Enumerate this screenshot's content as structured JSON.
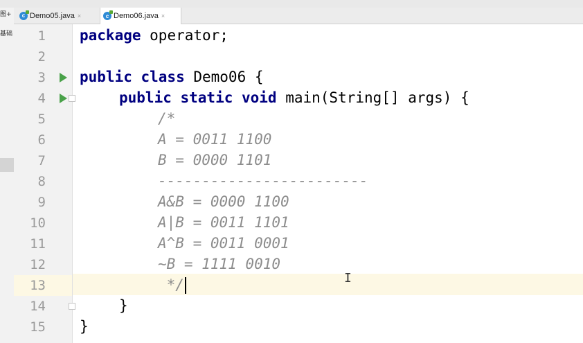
{
  "left_pane": {
    "label_1": "图+",
    "label_2": "基础"
  },
  "tabs": [
    {
      "name": "Demo05.java",
      "active": false,
      "close": "×",
      "icon": "java-class-icon"
    },
    {
      "name": "Demo06.java",
      "active": true,
      "close": "×",
      "icon": "java-class-icon"
    }
  ],
  "gutter": {
    "line_numbers": [
      "1",
      "2",
      "3",
      "4",
      "5",
      "6",
      "7",
      "8",
      "9",
      "10",
      "11",
      "12",
      "13",
      "14",
      "15"
    ],
    "run_markers_on_lines": [
      3,
      4
    ],
    "fold_markers_on_lines": [
      4,
      14
    ]
  },
  "code": {
    "l1_kw": "package",
    "l1_rest": " operator;",
    "l3_kw": "public class",
    "l3_rest": " Demo06 {",
    "l4_kw": "public static void",
    "l4_rest": " main(String[] args) {",
    "l5": "/*",
    "l6": "A = 0011 1100",
    "l7": "B = 0000 1101",
    "l8": "------------------------",
    "l9": "A&B = 0000 1100",
    "l10": "A|B = 0011 1101",
    "l11": "A^B = 0011 0001",
    "l12": "~B = 1111 0010",
    "l13": " */",
    "l14": "}",
    "l15": "}"
  },
  "editor": {
    "caret_line": 13,
    "mouse_cursor_glyph": "I",
    "keyword_color": "#000080",
    "comment_color": "#8c8c8c",
    "caret_row_color": "#fdf8e4"
  }
}
